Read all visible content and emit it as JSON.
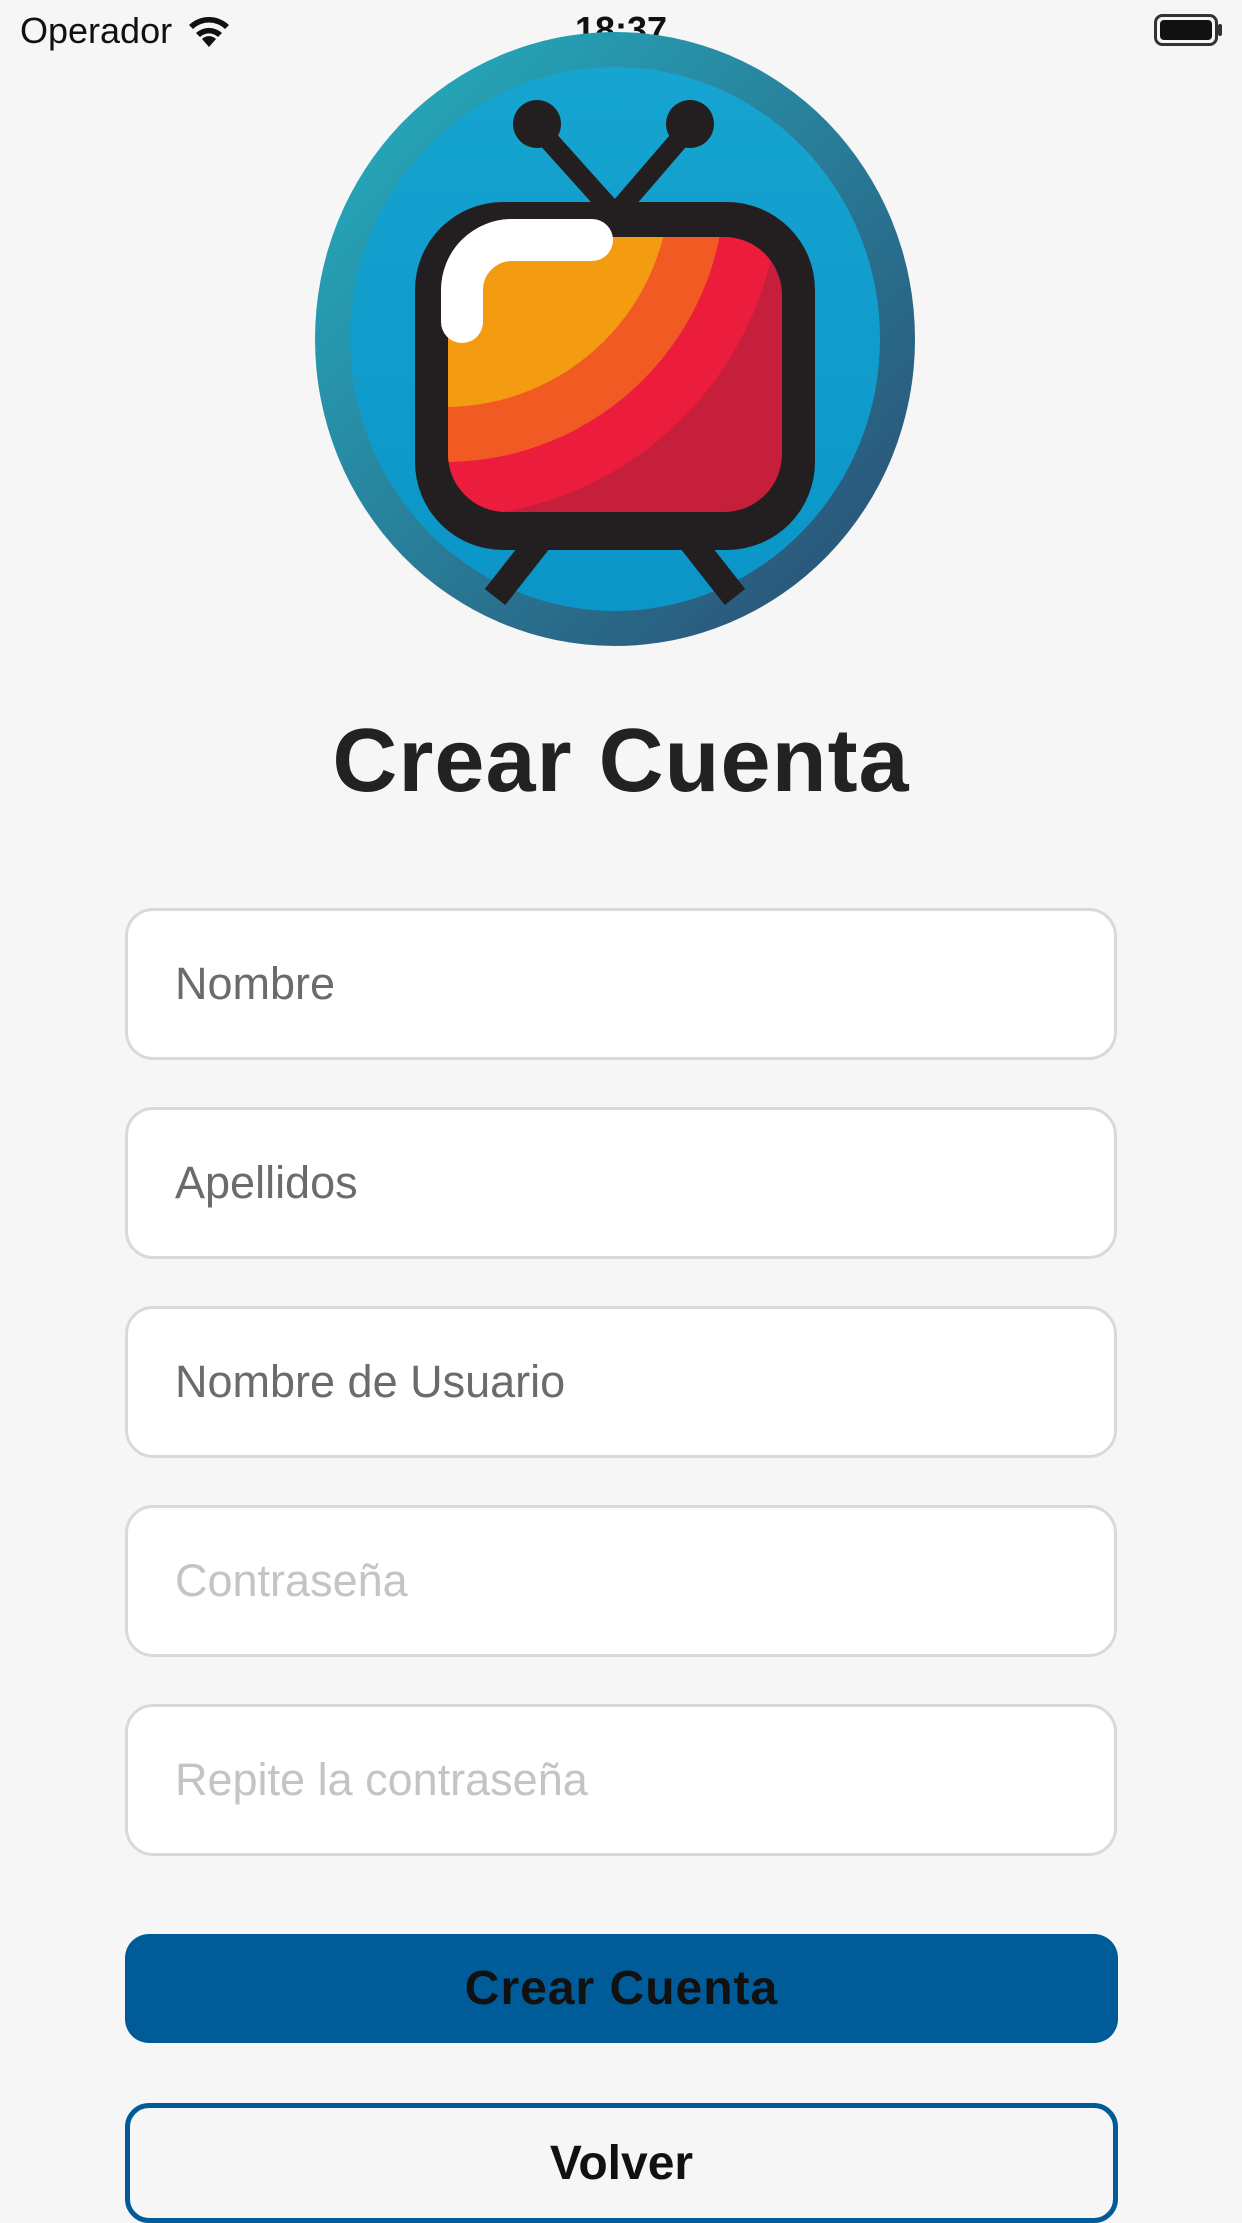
{
  "status_bar": {
    "carrier": "Operador",
    "time": "18:37"
  },
  "logo": {
    "icon": "retro-tv-logo-icon"
  },
  "title": "Crear Cuenta",
  "form": {
    "fields": [
      {
        "name": "nombre",
        "placeholder": "Nombre"
      },
      {
        "name": "apellidos",
        "placeholder": "Apellidos"
      },
      {
        "name": "usuario",
        "placeholder": "Nombre de Usuario"
      },
      {
        "name": "contrasena",
        "placeholder": "Contraseña"
      },
      {
        "name": "repite-contrasena",
        "placeholder": "Repite la contraseña"
      }
    ]
  },
  "buttons": {
    "create_label": "Crear Cuenta",
    "back_label": "Volver"
  },
  "colors": {
    "primary": "#005c99",
    "background": "#f6f6f6",
    "field_border": "#d9d9d9"
  }
}
